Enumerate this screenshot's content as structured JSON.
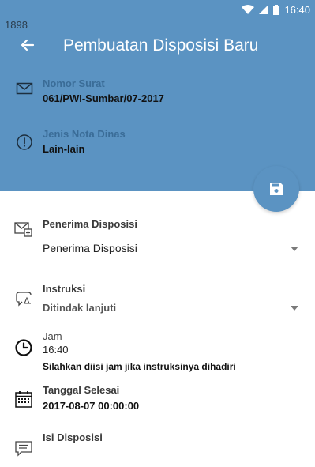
{
  "status_bar": {
    "left_text": "1898",
    "time": "16:40"
  },
  "header": {
    "title": "Pembuatan Disposisi Baru",
    "nomor_surat": {
      "label": "Nomor Surat",
      "value": "061/PWI-Sumbar/07-2017"
    },
    "jenis_nota": {
      "label": "Jenis Nota Dinas",
      "value": "Lain-lain"
    }
  },
  "form": {
    "penerima": {
      "label": "Penerima Disposisi",
      "selected": "Penerima Disposisi"
    },
    "instruksi": {
      "label": "Instruksi",
      "selected": "Ditindak lanjuti"
    },
    "jam": {
      "label": "Jam",
      "value": "16:40",
      "hint": "Silahkan diisi jam jika instruksinya dihadiri"
    },
    "tanggal": {
      "label": "Tanggal Selesai",
      "value": "2017-08-07 00:00:00"
    },
    "isi": {
      "label": "Isi Disposisi"
    }
  },
  "icons": {
    "back": "arrow-left-icon",
    "save": "floppy-disk-icon",
    "mail": "envelope-icon",
    "alert": "alert-circle-icon",
    "recipient": "mail-forward-icon",
    "instruction": "comment-icon",
    "clock": "clock-icon",
    "calendar": "calendar-icon",
    "message": "message-icon"
  },
  "colors": {
    "primary": "#5b93c2",
    "label_on_primary": "#3a6c97"
  }
}
